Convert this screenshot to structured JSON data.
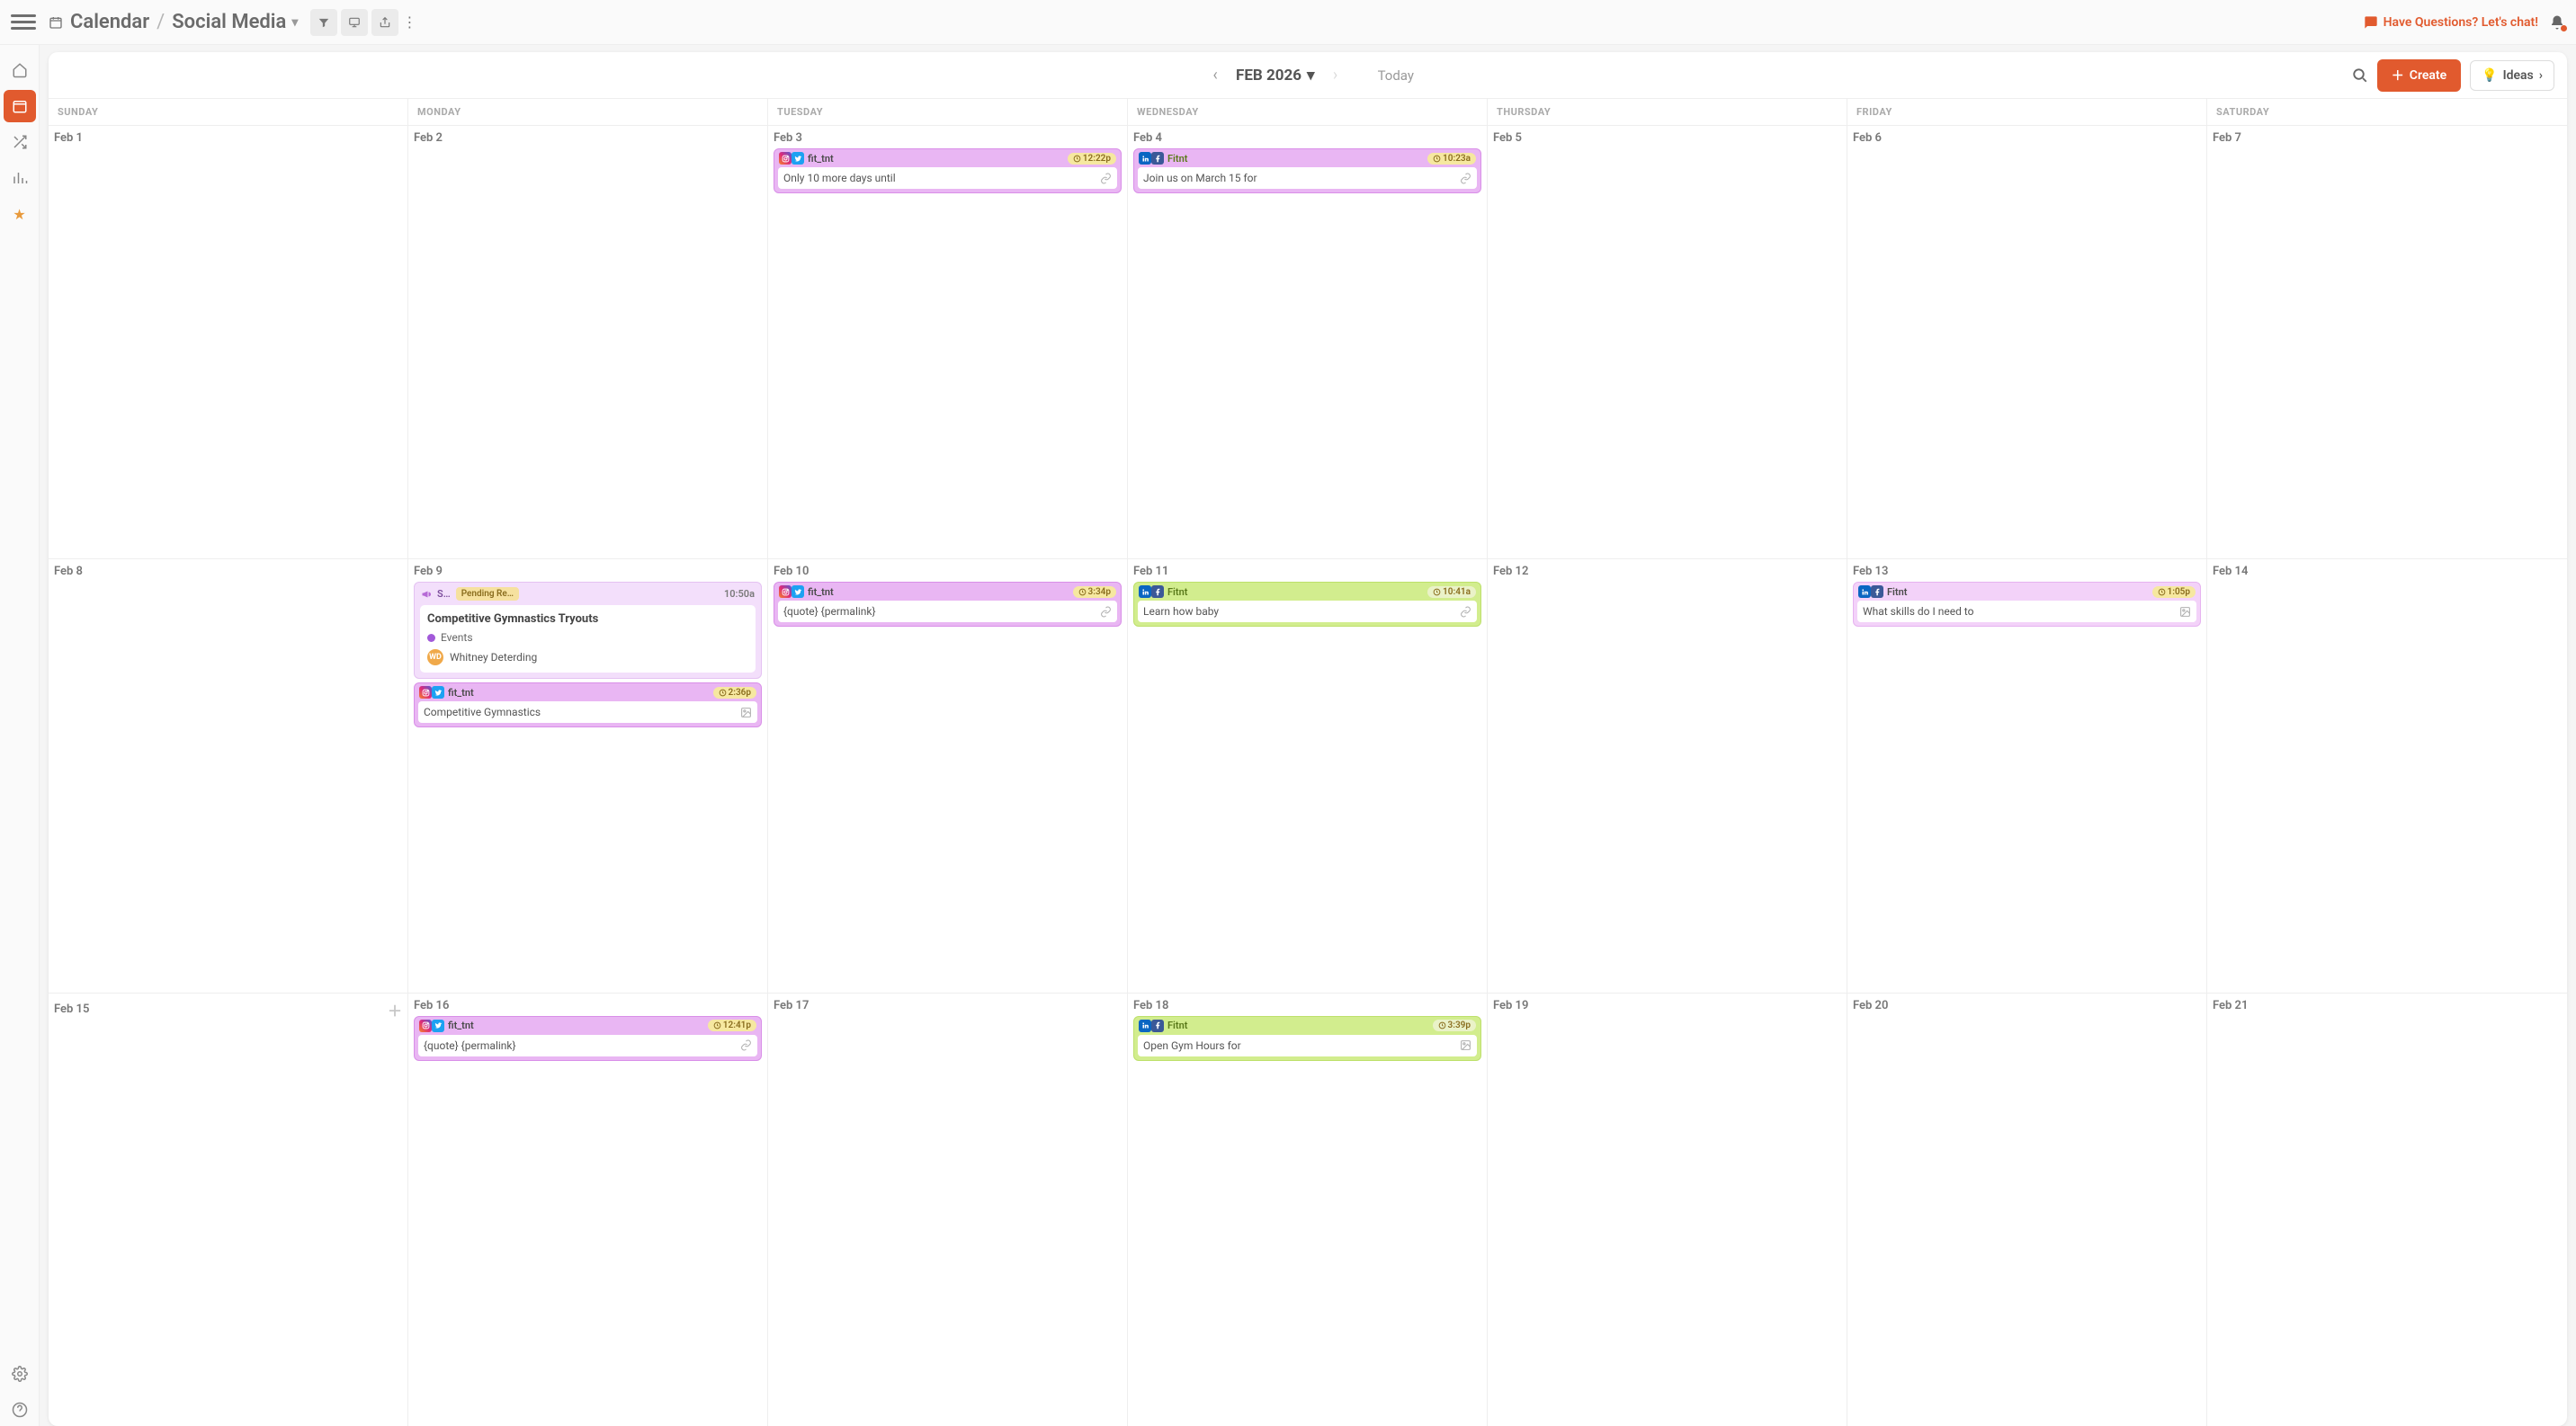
{
  "breadcrumb": {
    "root": "Calendar",
    "leaf": "Social Media"
  },
  "chat_link": "Have Questions? Let's chat!",
  "month_label": "FEB 2026",
  "today_label": "Today",
  "create_label": "Create",
  "ideas_label": "Ideas",
  "day_headers": [
    "SUNDAY",
    "MONDAY",
    "TUESDAY",
    "WEDNESDAY",
    "THURSDAY",
    "FRIDAY",
    "SATURDAY"
  ],
  "weeks": [
    [
      {
        "date": "Feb 1",
        "items": []
      },
      {
        "date": "Feb 2",
        "items": []
      },
      {
        "date": "Feb 3",
        "items": [
          {
            "type": "social",
            "color": "purple",
            "icons": [
              "ig",
              "tw"
            ],
            "handle": "fit_tnt",
            "time": "12:22p",
            "body": "Only 10 more days until",
            "body_icon": "link"
          }
        ]
      },
      {
        "date": "Feb 4",
        "items": [
          {
            "type": "social",
            "color": "purple",
            "icons": [
              "li",
              "fb"
            ],
            "handle": "Fitnt",
            "handle_class": "green",
            "time": "10:23a",
            "body": "Join us on March 15 for",
            "body_icon": "link"
          }
        ]
      },
      {
        "date": "Feb 5",
        "items": []
      },
      {
        "date": "Feb 6",
        "items": []
      },
      {
        "date": "Feb 7",
        "items": []
      }
    ],
    [
      {
        "date": "Feb 8",
        "items": []
      },
      {
        "date": "Feb 9",
        "items": [
          {
            "type": "campaign",
            "label": "S…",
            "status": "Pending Re…",
            "time": "10:50a",
            "title": "Competitive Gymnastics Tryouts",
            "tag": "Events",
            "owner": "Whitney Deterding",
            "owner_initials": "WD"
          },
          {
            "type": "social",
            "color": "purple",
            "icons": [
              "ig",
              "tw"
            ],
            "handle": "fit_tnt",
            "time": "2:36p",
            "body": "Competitive Gymnastics",
            "body_icon": "image"
          }
        ]
      },
      {
        "date": "Feb 10",
        "items": [
          {
            "type": "social",
            "color": "purple",
            "icons": [
              "ig",
              "tw"
            ],
            "handle": "fit_tnt",
            "time": "3:34p",
            "body": "{quote} {permalink}",
            "body_icon": "link"
          }
        ]
      },
      {
        "date": "Feb 11",
        "items": [
          {
            "type": "social",
            "color": "lime",
            "icons": [
              "li",
              "fb"
            ],
            "handle": "Fitnt",
            "handle_class": "green",
            "time": "10:41a",
            "time_class": "green",
            "body": "Learn how baby",
            "body_icon": "link"
          }
        ]
      },
      {
        "date": "Feb 12",
        "items": []
      },
      {
        "date": "Feb 13",
        "items": [
          {
            "type": "social",
            "color": "pink",
            "icons": [
              "li",
              "fb"
            ],
            "handle": "Fitnt",
            "time": "1:05p",
            "body": "What skills do I need to",
            "body_icon": "image"
          }
        ]
      },
      {
        "date": "Feb 14",
        "items": []
      }
    ],
    [
      {
        "date": "Feb 15",
        "show_plus": true,
        "items": []
      },
      {
        "date": "Feb 16",
        "items": [
          {
            "type": "social",
            "color": "purple",
            "icons": [
              "ig",
              "tw"
            ],
            "handle": "fit_tnt",
            "time": "12:41p",
            "body": "{quote} {permalink}",
            "body_icon": "link"
          }
        ]
      },
      {
        "date": "Feb 17",
        "items": []
      },
      {
        "date": "Feb 18",
        "items": [
          {
            "type": "social",
            "color": "lime",
            "icons": [
              "li",
              "fb"
            ],
            "handle": "Fitnt",
            "handle_class": "green",
            "time": "3:39p",
            "time_class": "green",
            "body": "Open Gym Hours for",
            "body_icon": "image"
          }
        ]
      },
      {
        "date": "Feb 19",
        "items": []
      },
      {
        "date": "Feb 20",
        "items": []
      },
      {
        "date": "Feb 21",
        "items": []
      }
    ]
  ]
}
